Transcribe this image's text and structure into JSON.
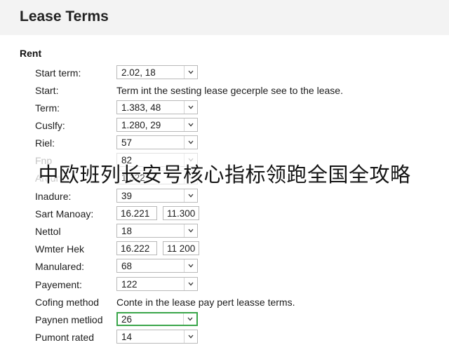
{
  "header": {
    "title": "Lease Terms"
  },
  "section": {
    "title": "Rent"
  },
  "rows": [
    {
      "label": "Start term:",
      "value": "2.02, 18"
    },
    {
      "label": "Start:",
      "description": "Term int the sesting lease gecerple see to the lease."
    },
    {
      "label": "Term:",
      "value": "1.383, 48"
    },
    {
      "label": "Cuslfy:",
      "value": "1.280, 29"
    },
    {
      "label": "Riel:",
      "value": "57"
    },
    {
      "label": "Fnp",
      "value": "82"
    },
    {
      "label": "Aroun",
      "value": "1 322"
    },
    {
      "label": "Inadure:",
      "value": "39"
    },
    {
      "label": "Sart Manoay:",
      "value1": "16.221",
      "value2": "11.300"
    },
    {
      "label": "Nettol",
      "value": "18"
    },
    {
      "label": "Wmter Hek",
      "value1": "16.222",
      "value2": "11 200"
    },
    {
      "label": "Manulared:",
      "value": "68"
    },
    {
      "label": "Payement:",
      "value": "122"
    },
    {
      "label": "Cofing method",
      "description": "Conte in the lease pay pert leasse terms."
    },
    {
      "label": "Paynen metliod",
      "value": "26"
    },
    {
      "label": "Pumont rated",
      "value": "14"
    }
  ],
  "overlay": {
    "text": "中欧班列长安号核心指标领跑全国全攻略"
  },
  "colors": {
    "header_bg": "#f3f3f3",
    "active_border": "#3aa64a",
    "field_border": "#b9b9b9"
  },
  "icons": {
    "dropdown": "chevron-down-icon"
  }
}
